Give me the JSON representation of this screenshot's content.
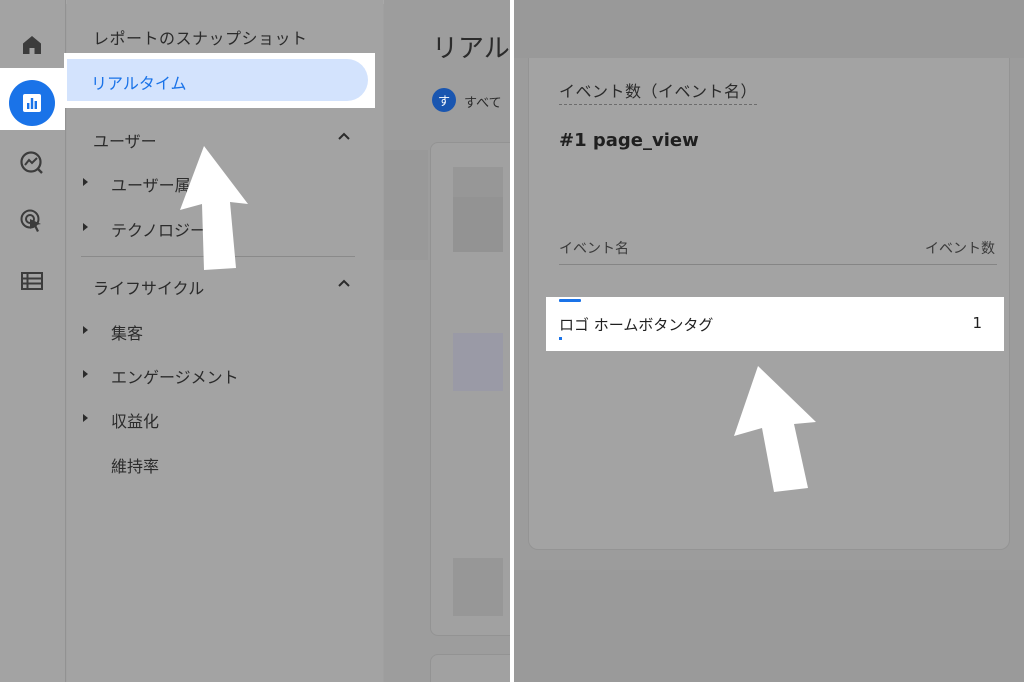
{
  "left": {
    "nav_title": "レポートのスナップショット",
    "selected_item": "リアルタイム",
    "sections": [
      {
        "label": "ユーザー",
        "items": [
          "ユーザー属性",
          "テクノロジー"
        ]
      },
      {
        "label": "ライフサイクル",
        "items": [
          "集客",
          "エンゲージメント",
          "収益化",
          "維持率"
        ]
      }
    ],
    "peek_title": "リアル",
    "peek_chip_letter": "す",
    "peek_chip_text": "すべて"
  },
  "right": {
    "card_title": "イベント数（イベント名）",
    "top_item": "#1  page_view",
    "col_event_name": "イベント名",
    "col_event_count": "イベント数",
    "row": {
      "label": "ロゴ ホームボタンタグ",
      "value": "1"
    }
  },
  "icons": {
    "rail": [
      "home-icon",
      "reports-icon",
      "explore-icon",
      "advertising-icon",
      "configure-icon"
    ],
    "pointer": "up-arrow-icon"
  },
  "colors": {
    "accent": "#1a73e8",
    "selected_bg": "#d3e3fd",
    "highlight": "#ffffff",
    "dim_overlay": "#a0a0a0"
  }
}
